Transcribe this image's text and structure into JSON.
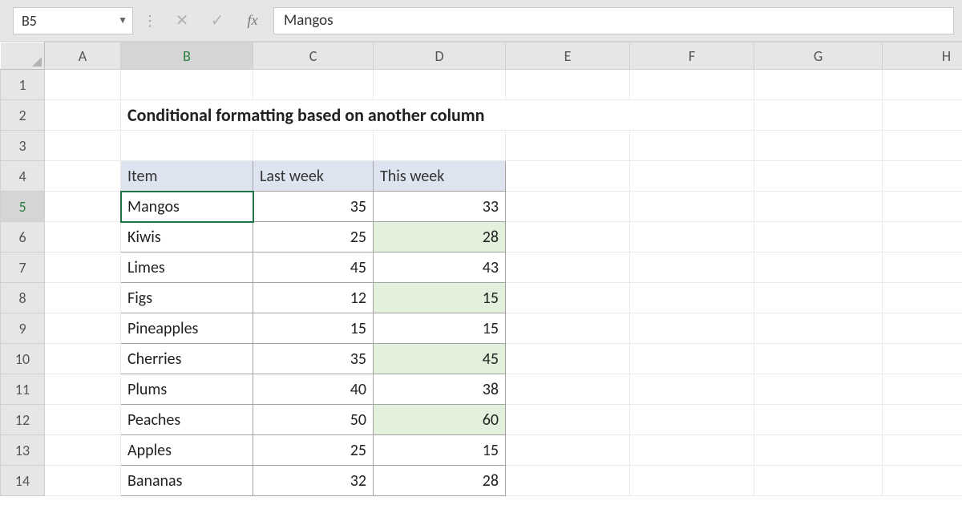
{
  "nameBox": "B5",
  "formulaValue": "Mangos",
  "columns": [
    "A",
    "B",
    "C",
    "D",
    "E",
    "F",
    "G",
    "H"
  ],
  "rowCount": 14,
  "selectedCell": {
    "row": 5,
    "col": "B"
  },
  "title": "Conditional formatting based on another column",
  "titleCell": {
    "row": 2,
    "col": "B",
    "colspan": 5
  },
  "table": {
    "topRow": 4,
    "startCol": "B",
    "headers": [
      "Item",
      "Last week",
      "This week"
    ],
    "rows": [
      {
        "item": "Mangos",
        "last": 35,
        "this": 33,
        "highlight": false
      },
      {
        "item": "Kiwis",
        "last": 25,
        "this": 28,
        "highlight": true
      },
      {
        "item": "Limes",
        "last": 45,
        "this": 43,
        "highlight": false
      },
      {
        "item": "Figs",
        "last": 12,
        "this": 15,
        "highlight": true
      },
      {
        "item": "Pineapples",
        "last": 15,
        "this": 15,
        "highlight": false
      },
      {
        "item": "Cherries",
        "last": 35,
        "this": 45,
        "highlight": true
      },
      {
        "item": "Plums",
        "last": 40,
        "this": 38,
        "highlight": false
      },
      {
        "item": "Peaches",
        "last": 50,
        "this": 60,
        "highlight": true
      },
      {
        "item": "Apples",
        "last": 25,
        "this": 15,
        "highlight": false
      },
      {
        "item": "Bananas",
        "last": 32,
        "this": 28,
        "highlight": false
      }
    ]
  },
  "colors": {
    "headerFill": "#dde4f0",
    "highlightFill": "#e3f0db",
    "selectionBorder": "#217346"
  }
}
